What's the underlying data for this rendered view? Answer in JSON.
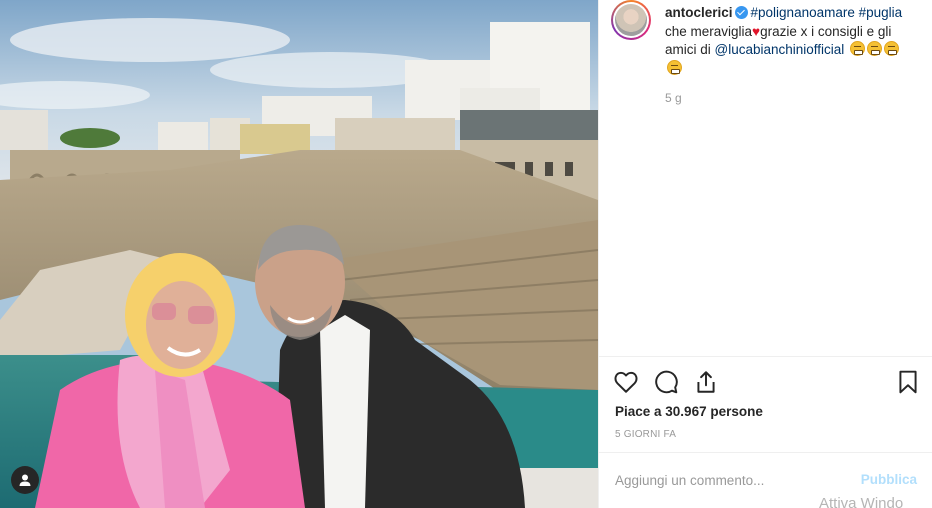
{
  "post": {
    "username": "antoclerici",
    "caption_tag_1": "#polignanoamare",
    "caption_tag_2": "#puglia",
    "caption_text_1": "che meraviglia",
    "caption_text_2": "grazie x i consigli e gli amici di",
    "caption_mention": "@lucabianchiniofficial",
    "time_ago": "5 g",
    "likes": "Piace a 30.967 persone",
    "date": "5 GIORNI FA"
  },
  "icons": {
    "like": "heart-icon",
    "comment": "comment-icon",
    "share": "share-icon",
    "save": "bookmark-icon",
    "tag": "person-tag-icon",
    "verified": "verified-badge-icon"
  },
  "comment_box": {
    "placeholder": "Aggiungi un commento...",
    "publish_label": "Pubblica"
  },
  "system": {
    "watermark": "Attiva Windo"
  },
  "colors": {
    "link": "#003569",
    "verified": "#3897f0",
    "publish_disabled": "#b2dffc",
    "secondary_text": "#999999"
  }
}
